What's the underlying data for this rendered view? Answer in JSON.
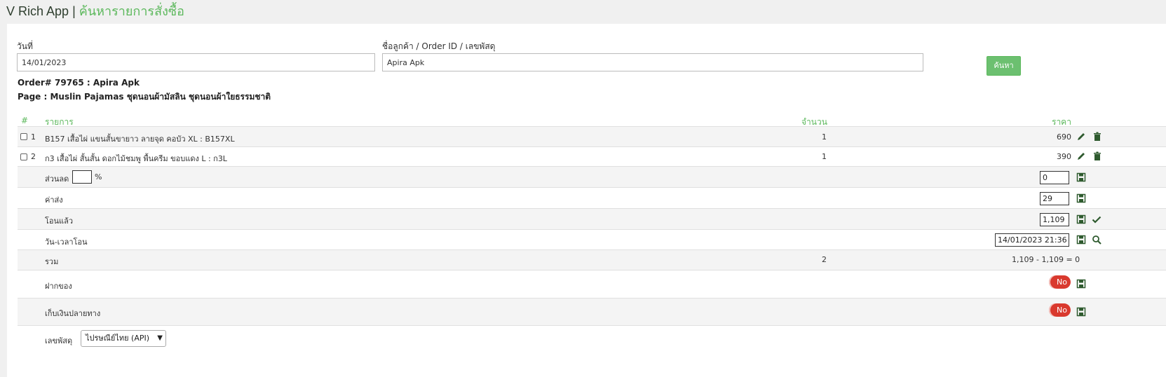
{
  "header": {
    "app_name": "V Rich App",
    "separator": "|",
    "page_title": "ค้นหารายการสั่งซื้อ"
  },
  "search": {
    "date_label": "วันที่",
    "date_value": "14/01/2023",
    "query_label": "ชื่อลูกค้า / Order ID / เลขพัสดุ",
    "query_value": "Apira Apk",
    "button_label": "ค้นหา"
  },
  "order": {
    "order_line": "Order# 79765 : Apira Apk",
    "page_line": "Page : Muslin Pajamas ชุดนอนผ้ามัสลิน ชุดนอนผ้าใยธรรมชาติ"
  },
  "table": {
    "headers": {
      "num": "#",
      "item": "รายการ",
      "qty": "จำนวน",
      "price": "ราคา"
    },
    "items": [
      {
        "num": "1",
        "name": "B157 เสื้อไผ่ แขนสั้นขายาว ลายจุด คอบัว XL : B157XL",
        "qty": "1",
        "price": "690"
      },
      {
        "num": "2",
        "name": "ก3 เสื้อไผ่ สั้นสั้น ดอกไม้ชมพู พื้นครีม ขอบแดง L : ก3L",
        "qty": "1",
        "price": "390"
      }
    ],
    "discount": {
      "label": "ส่วนลด",
      "percent_value": "",
      "percent_sign": "%",
      "value": "0"
    },
    "shipping": {
      "label": "ค่าส่ง",
      "value": "29"
    },
    "transferred": {
      "label": "โอนแล้ว",
      "value": "1,109"
    },
    "transfer_time": {
      "label": "วัน-เวลาโอน",
      "value": "14/01/2023 21:36"
    },
    "total": {
      "label": "รวม",
      "qty": "2",
      "summary": "1,109 - 1,109 = 0"
    },
    "deposit": {
      "label": "ฝากของ",
      "toggle": "No"
    },
    "cod": {
      "label": "เก็บเงินปลายทาง",
      "toggle": "No"
    },
    "tracking": {
      "label": "เลขพัสดุ",
      "selected": "ไปรษณีย์ไทย (API)"
    }
  },
  "colors": {
    "accent": "#5cb85c",
    "toggle_off": "#d9392e",
    "icon": "#2e5a2e"
  },
  "icons": [
    "pencil-icon",
    "trash-icon",
    "floppy-icon",
    "check-icon",
    "search-icon",
    "chevron-down-icon"
  ]
}
